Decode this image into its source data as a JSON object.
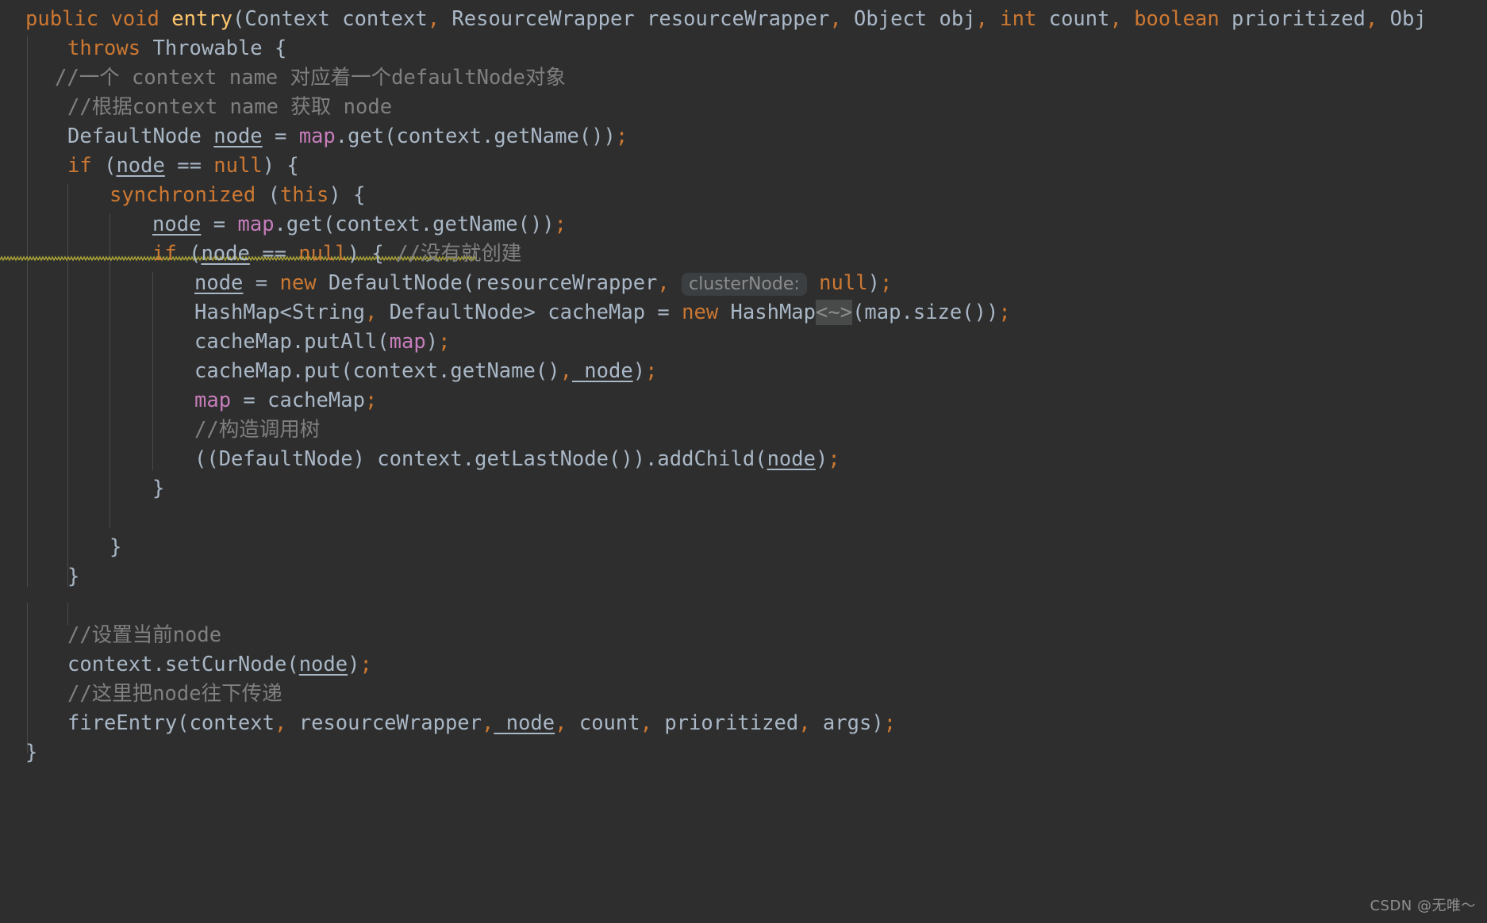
{
  "editor": {
    "theme": "darcula",
    "background": "#2e2e2e",
    "default_text_color": "#a9b7c6",
    "keyword_color": "#cc7832",
    "comment_color": "#808080",
    "field_color": "#c77dbb",
    "method_color": "#ffc66d",
    "warning_squiggle_color": "#a9a336",
    "language": "Java"
  },
  "code": {
    "l01": {
      "kw_public": "public",
      "kw_void": "void",
      "method_name": "entry",
      "paren_open": "(",
      "type_context": "Context",
      "param_context": " context",
      "comma1": ",",
      "type_wrapper": " ResourceWrapper",
      "param_wrapper": " resourceWrapper",
      "comma2": ",",
      "type_object": " Object",
      "param_obj": " obj",
      "comma3": ",",
      "kw_int": "int",
      "param_count": " count",
      "comma4": ",",
      "kw_boolean": "boolean",
      "param_prioritized": " prioritized",
      "comma5": ",",
      "type_obj_tail": " Obj"
    },
    "l02": {
      "kw_throws": "throws",
      "type": " Throwable ",
      "brace": "{"
    },
    "l03": {
      "comment": "//一个 context name 对应着一个defaultNode对象"
    },
    "l04": {
      "comment": "//根据context name 获取 node"
    },
    "l05": {
      "type": "DefaultNode ",
      "var": "node",
      "eq": " = ",
      "field": "map",
      "call": ".get(context.getName())",
      "semi": ";"
    },
    "l06": {
      "kw_if": "if",
      "p1": " (",
      "var": "node",
      "eqeq": " == ",
      "kw_null": "null",
      "p2": ") ",
      "brace": "{"
    },
    "l07": {
      "kw_sync": "synchronized",
      "p1": " (",
      "kw_this": "this",
      "p2": ") ",
      "brace": "{"
    },
    "l08": {
      "var": "node",
      "eq": " = ",
      "field": "map",
      "call": ".get(context.getName())",
      "semi": ";"
    },
    "l09": {
      "kw_if": "if",
      "p1": " (",
      "var": "node",
      "eqeq": " == ",
      "kw_null": "null",
      "p2": ") ",
      "brace": "{ ",
      "comment": "//没有就创建"
    },
    "l10": {
      "var": "node",
      "eq": " = ",
      "kw_new": "new",
      "ctor": " DefaultNode(resourceWrapper",
      "comma": ",",
      "hint": "clusterNode:",
      "kw_null": "null",
      "close": ")",
      "semi": ";"
    },
    "l11": {
      "type": "HashMap<String",
      "comma": ",",
      "type2": " DefaultNode> cacheMap",
      "eq": " = ",
      "kw_new": "new",
      "ctor": " HashMap",
      "fold": "<~>",
      "args": "(map.size())",
      "semi": ";"
    },
    "l12": {
      "call": "cacheMap.putAll(",
      "field": "map",
      "close": ")",
      "semi": ";"
    },
    "l13": {
      "call": "cacheMap.put(context.getName()",
      "comma": ",",
      "var": " node",
      "close": ")",
      "semi": ";"
    },
    "l14": {
      "field": "map",
      "eq": " = ",
      "rhs": "cacheMap",
      "semi": ";"
    },
    "l15": {
      "comment": "//构造调用树"
    },
    "l16": {
      "cast": "((DefaultNode) context.getLastNode()).addChild(",
      "var": "node",
      "close": ")",
      "semi": ";"
    },
    "l17": {
      "brace": "}"
    },
    "l18": {
      "brace": "}"
    },
    "l19": {
      "brace": "}"
    },
    "l20": {
      "comment": "//设置当前node"
    },
    "l21": {
      "call": "context.setCurNode(",
      "var": "node",
      "close": ")",
      "semi": ";"
    },
    "l22": {
      "comment": "//这里把node往下传递"
    },
    "l23": {
      "call": "fireEntry(context",
      "comma1": ",",
      "a2": " resourceWrapper",
      "comma2": ",",
      "var": " node",
      "comma3": ",",
      "a4": " count",
      "comma4": ",",
      "a5": " prioritized",
      "comma5": ",",
      "a6": " args",
      "close": ")",
      "semi": ";"
    },
    "l24": {
      "brace": "}"
    }
  },
  "watermark": {
    "text": "CSDN @无唯～"
  }
}
